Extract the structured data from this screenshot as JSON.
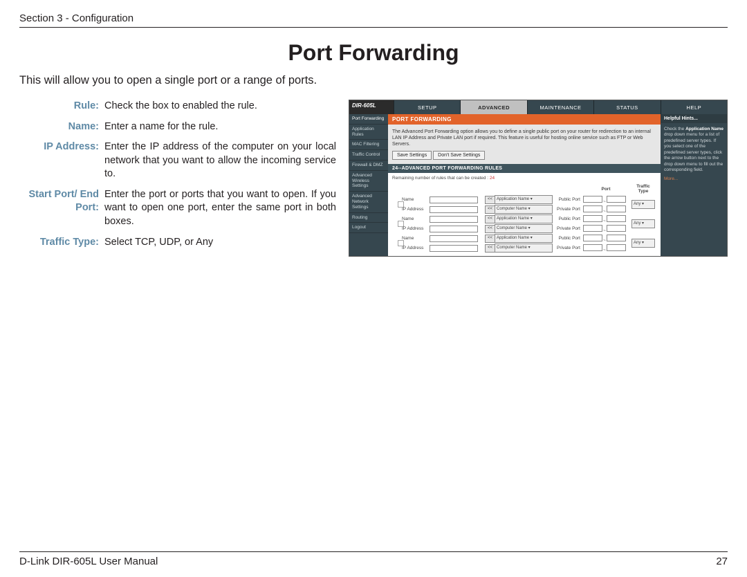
{
  "header": {
    "section": "Section 3 - Configuration"
  },
  "title": "Port Forwarding",
  "intro": "This will allow you to open a single port or a range of ports.",
  "defs": [
    {
      "label": "Rule:",
      "value": "Check the box to enabled the rule."
    },
    {
      "label": "Name:",
      "value": "Enter a name for the rule."
    },
    {
      "label": "IP Address:",
      "value": "Enter the IP address of the computer on your local network that you want to allow the incoming service to."
    },
    {
      "label": "Start Port/ End Port:",
      "value": "Enter the port or ports that you want to open. If you want to open one port, enter the same port in both boxes."
    },
    {
      "label": "Traffic Type:",
      "value": "Select TCP, UDP, or Any"
    }
  ],
  "screenshot": {
    "model": "DIR-605L",
    "tabs": [
      "SETUP",
      "ADVANCED",
      "MAINTENANCE",
      "STATUS",
      "HELP"
    ],
    "active_tab_index": 1,
    "leftnav": [
      "Port Forwarding",
      "Application Rules",
      "MAC Filtering",
      "Traffic Control",
      "Firewall & DMZ",
      "Advanced Wireless Settings",
      "Advanced Network Settings",
      "Routing",
      "Logout"
    ],
    "leftnav_active_index": 0,
    "main": {
      "heading": "PORT FORWARDING",
      "desc": "The Advanced Port Forwarding option allows you to define a single public port on your router for redirection to an internal LAN IP Address and Private LAN port if required. This feature is useful for hosting online service such as FTP or Web Servers.",
      "btn_save": "Save Settings",
      "btn_cancel": "Don't Save Settings",
      "rules_heading": "24--ADVANCED PORT FORWARDING RULES",
      "remaining_label": "Remaining number of rules that can be created :",
      "remaining_value": "24",
      "col_port": "Port",
      "col_traffic": "Traffic Type",
      "row_labels": {
        "name": "Name",
        "ip": "IP Address",
        "public": "Public Port",
        "private": "Private Port"
      },
      "lt": "<<",
      "sel_app": "Application Name ▾",
      "sel_comp": "Computer Name ▾",
      "sel_any": "Any ▾",
      "tilde": "~"
    },
    "hints": {
      "head": "Helpful Hints...",
      "body_bold": "Application Name",
      "body_prefix": "Check the ",
      "body_rest": " drop down menu for a list of predefined server types. If you select one of the predefined server types, click the arrow button next to the drop down menu to fill out the corresponding field.",
      "more": "More..."
    }
  },
  "footer": {
    "manual": "D-Link DIR-605L User Manual",
    "page": "27"
  }
}
